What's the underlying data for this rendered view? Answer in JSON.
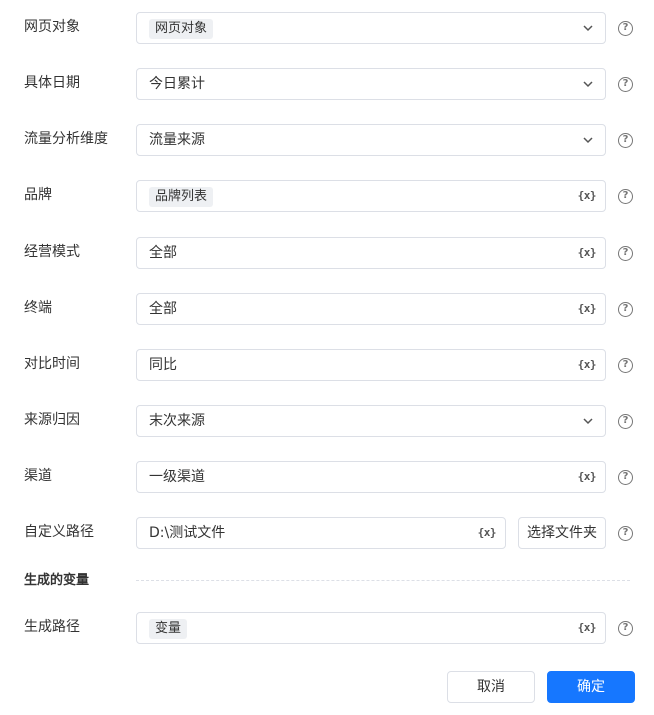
{
  "fields": [
    {
      "label": "网页对象",
      "value": "网页对象",
      "kind": "select-tag"
    },
    {
      "label": "具体日期",
      "value": "今日累计",
      "kind": "select"
    },
    {
      "label": "流量分析维度",
      "value": "流量来源",
      "kind": "select"
    },
    {
      "label": "品牌",
      "value": "品牌列表",
      "kind": "var-tag"
    },
    {
      "label": "经营模式",
      "value": "全部",
      "kind": "var"
    },
    {
      "label": "终端",
      "value": "全部",
      "kind": "var"
    },
    {
      "label": "对比时间",
      "value": "同比",
      "kind": "var"
    },
    {
      "label": "来源归因",
      "value": "末次来源",
      "kind": "select"
    },
    {
      "label": "渠道",
      "value": "一级渠道",
      "kind": "var"
    },
    {
      "label": "自定义路径",
      "value": "D:\\测试文件",
      "kind": "var"
    }
  ],
  "folder_button": "选择文件夹",
  "variable_icon": "{x}",
  "help_icon": "?",
  "section": {
    "title": "生成的变量"
  },
  "output": {
    "label": "生成路径",
    "value": "变量"
  },
  "buttons": {
    "cancel": "取消",
    "confirm": "确定"
  }
}
